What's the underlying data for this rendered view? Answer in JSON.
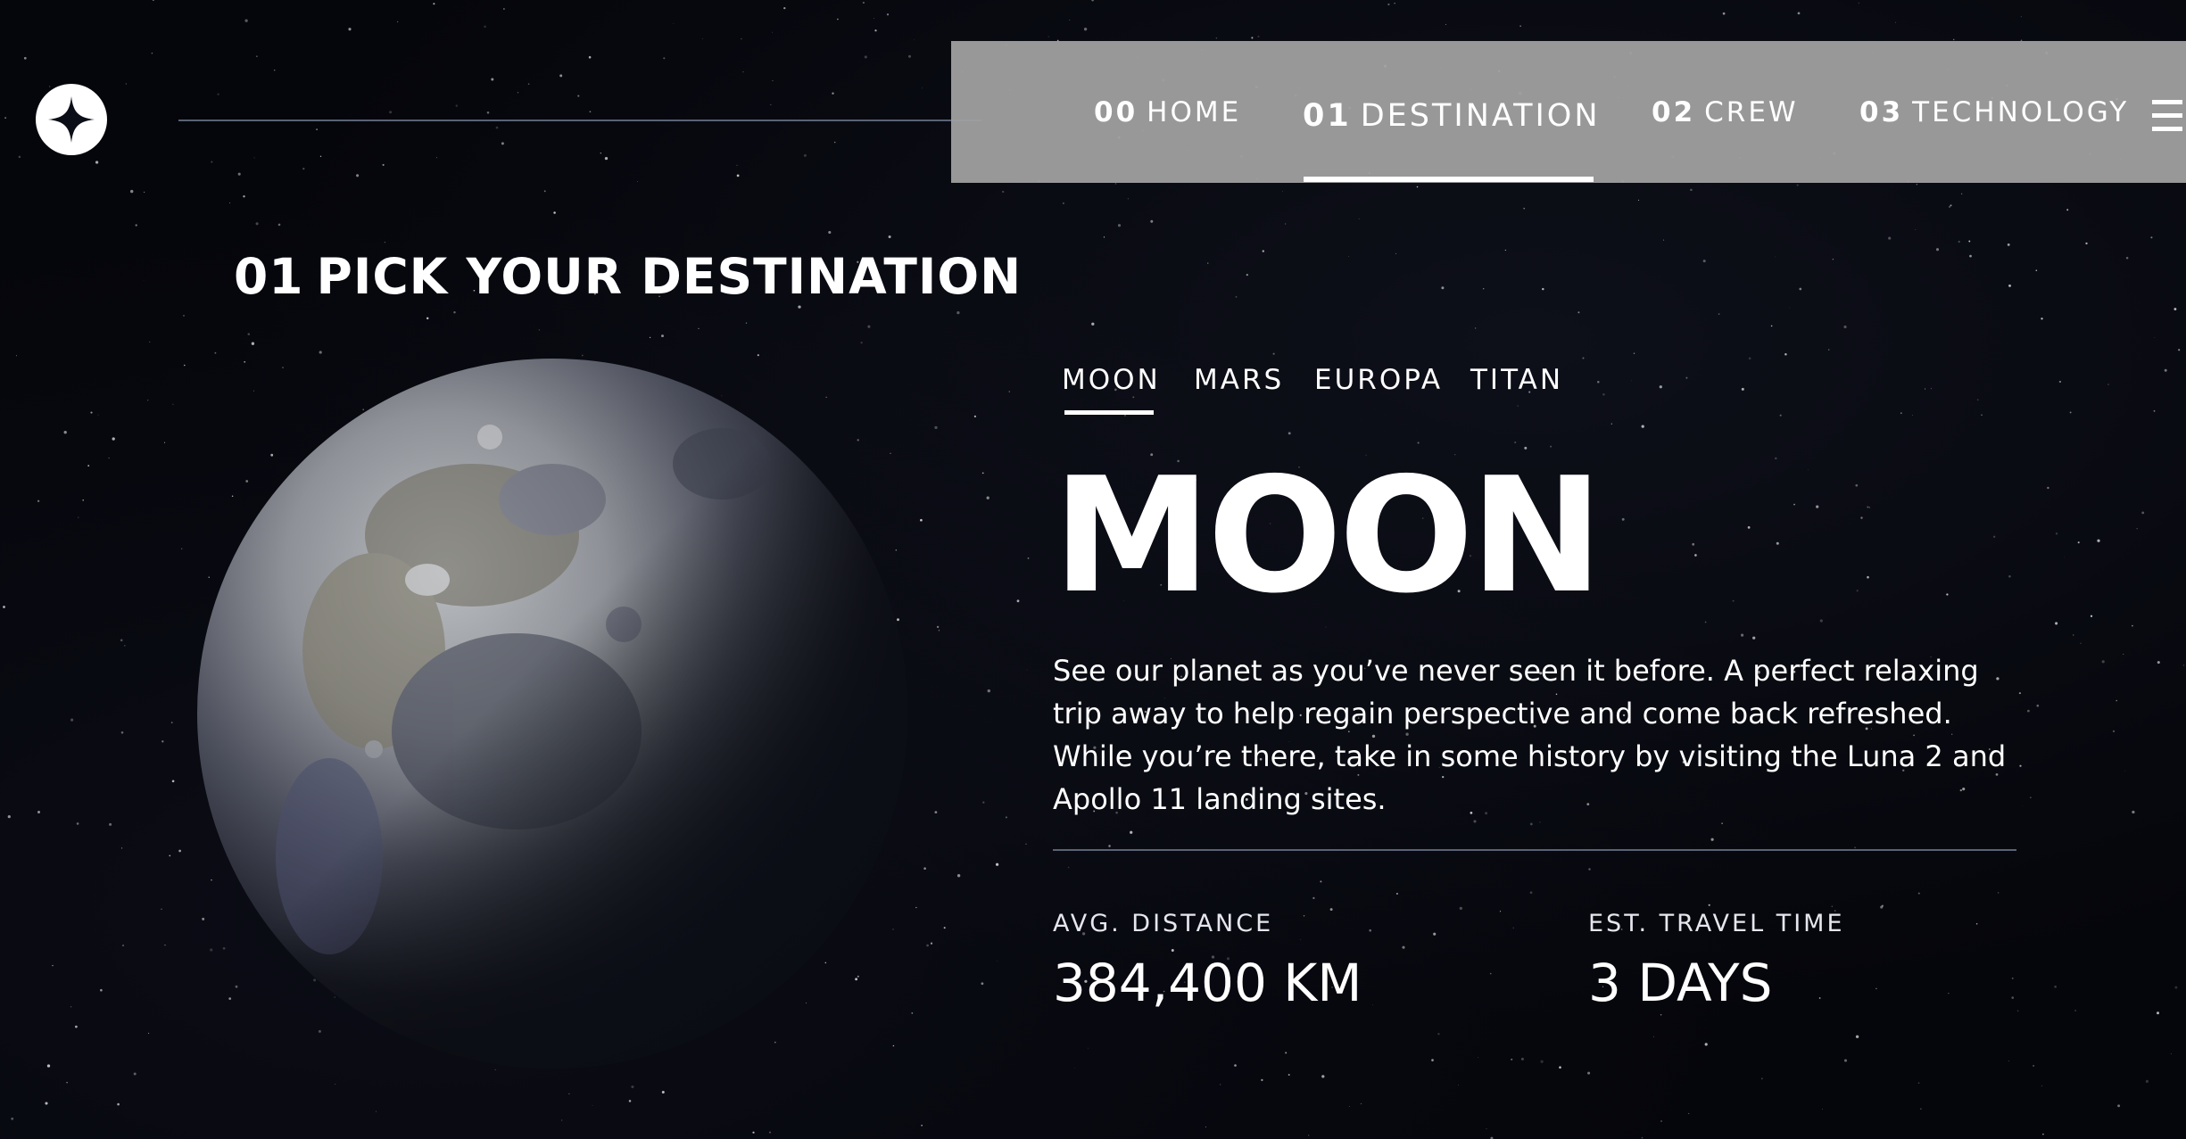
{
  "header": {
    "logo_icon": "star-logo-icon",
    "nav": [
      {
        "num": "00",
        "label": "HOME",
        "active": false
      },
      {
        "num": "01",
        "label": "DESTINATION",
        "active": true
      },
      {
        "num": "02",
        "label": "CREW",
        "active": false
      },
      {
        "num": "03",
        "label": "TECHNOLOGY",
        "active": false
      }
    ],
    "menu_icon": "hamburger-icon"
  },
  "page": {
    "heading_num": "01",
    "heading_text": "PICK YOUR DESTINATION"
  },
  "destinations": {
    "tabs": [
      "MOON",
      "MARS",
      "EUROPA",
      "TITAN"
    ],
    "active_tab": "MOON",
    "name": "MOON",
    "description": "See our planet as you’ve never seen it before. A perfect relaxing trip away to help regain perspective and come back refreshed. While you’re there, take in some history by visiting the Luna 2 and Apollo 11 landing sites.",
    "stats": {
      "distance_label": "AVG. DISTANCE",
      "distance_value": "384,400 KM",
      "travel_label": "EST. TRAVEL TIME",
      "travel_value": "3 DAYS"
    }
  },
  "colors": {
    "background": "#05060b",
    "nav_bar": "#a0a0a0",
    "divider": "#5a6275",
    "text": "#ffffff"
  }
}
